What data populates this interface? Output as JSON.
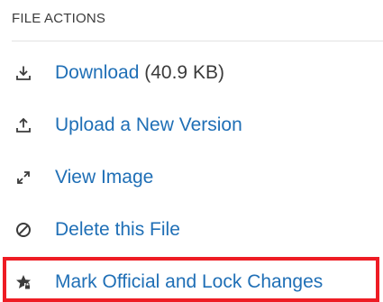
{
  "file_actions": {
    "header": "FILE ACTIONS",
    "download": {
      "label": "Download",
      "size": "(40.9 KB)",
      "icon": "download-icon"
    },
    "upload": {
      "label": "Upload a New Version",
      "icon": "upload-icon"
    },
    "view": {
      "label": "View Image",
      "icon": "expand-icon"
    },
    "delete": {
      "label": "Delete this File",
      "icon": "prohibited-icon"
    },
    "mark_official": {
      "label": "Mark Official and Lock Changes",
      "icon": "star-lock-icon"
    }
  },
  "colors": {
    "link": "#1f6fb6",
    "text": "#3b3b3b",
    "highlight": "#ee1c24"
  }
}
